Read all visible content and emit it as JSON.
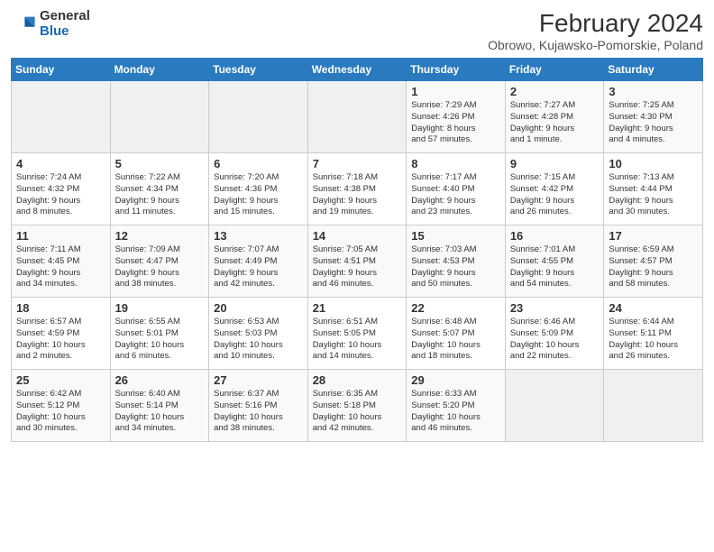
{
  "header": {
    "logo_general": "General",
    "logo_blue": "Blue",
    "title": "February 2024",
    "subtitle": "Obrowo, Kujawsko-Pomorskie, Poland"
  },
  "weekdays": [
    "Sunday",
    "Monday",
    "Tuesday",
    "Wednesday",
    "Thursday",
    "Friday",
    "Saturday"
  ],
  "weeks": [
    [
      {
        "day": "",
        "info": ""
      },
      {
        "day": "",
        "info": ""
      },
      {
        "day": "",
        "info": ""
      },
      {
        "day": "",
        "info": ""
      },
      {
        "day": "1",
        "info": "Sunrise: 7:29 AM\nSunset: 4:26 PM\nDaylight: 8 hours\nand 57 minutes."
      },
      {
        "day": "2",
        "info": "Sunrise: 7:27 AM\nSunset: 4:28 PM\nDaylight: 9 hours\nand 1 minute."
      },
      {
        "day": "3",
        "info": "Sunrise: 7:25 AM\nSunset: 4:30 PM\nDaylight: 9 hours\nand 4 minutes."
      }
    ],
    [
      {
        "day": "4",
        "info": "Sunrise: 7:24 AM\nSunset: 4:32 PM\nDaylight: 9 hours\nand 8 minutes."
      },
      {
        "day": "5",
        "info": "Sunrise: 7:22 AM\nSunset: 4:34 PM\nDaylight: 9 hours\nand 11 minutes."
      },
      {
        "day": "6",
        "info": "Sunrise: 7:20 AM\nSunset: 4:36 PM\nDaylight: 9 hours\nand 15 minutes."
      },
      {
        "day": "7",
        "info": "Sunrise: 7:18 AM\nSunset: 4:38 PM\nDaylight: 9 hours\nand 19 minutes."
      },
      {
        "day": "8",
        "info": "Sunrise: 7:17 AM\nSunset: 4:40 PM\nDaylight: 9 hours\nand 23 minutes."
      },
      {
        "day": "9",
        "info": "Sunrise: 7:15 AM\nSunset: 4:42 PM\nDaylight: 9 hours\nand 26 minutes."
      },
      {
        "day": "10",
        "info": "Sunrise: 7:13 AM\nSunset: 4:44 PM\nDaylight: 9 hours\nand 30 minutes."
      }
    ],
    [
      {
        "day": "11",
        "info": "Sunrise: 7:11 AM\nSunset: 4:45 PM\nDaylight: 9 hours\nand 34 minutes."
      },
      {
        "day": "12",
        "info": "Sunrise: 7:09 AM\nSunset: 4:47 PM\nDaylight: 9 hours\nand 38 minutes."
      },
      {
        "day": "13",
        "info": "Sunrise: 7:07 AM\nSunset: 4:49 PM\nDaylight: 9 hours\nand 42 minutes."
      },
      {
        "day": "14",
        "info": "Sunrise: 7:05 AM\nSunset: 4:51 PM\nDaylight: 9 hours\nand 46 minutes."
      },
      {
        "day": "15",
        "info": "Sunrise: 7:03 AM\nSunset: 4:53 PM\nDaylight: 9 hours\nand 50 minutes."
      },
      {
        "day": "16",
        "info": "Sunrise: 7:01 AM\nSunset: 4:55 PM\nDaylight: 9 hours\nand 54 minutes."
      },
      {
        "day": "17",
        "info": "Sunrise: 6:59 AM\nSunset: 4:57 PM\nDaylight: 9 hours\nand 58 minutes."
      }
    ],
    [
      {
        "day": "18",
        "info": "Sunrise: 6:57 AM\nSunset: 4:59 PM\nDaylight: 10 hours\nand 2 minutes."
      },
      {
        "day": "19",
        "info": "Sunrise: 6:55 AM\nSunset: 5:01 PM\nDaylight: 10 hours\nand 6 minutes."
      },
      {
        "day": "20",
        "info": "Sunrise: 6:53 AM\nSunset: 5:03 PM\nDaylight: 10 hours\nand 10 minutes."
      },
      {
        "day": "21",
        "info": "Sunrise: 6:51 AM\nSunset: 5:05 PM\nDaylight: 10 hours\nand 14 minutes."
      },
      {
        "day": "22",
        "info": "Sunrise: 6:48 AM\nSunset: 5:07 PM\nDaylight: 10 hours\nand 18 minutes."
      },
      {
        "day": "23",
        "info": "Sunrise: 6:46 AM\nSunset: 5:09 PM\nDaylight: 10 hours\nand 22 minutes."
      },
      {
        "day": "24",
        "info": "Sunrise: 6:44 AM\nSunset: 5:11 PM\nDaylight: 10 hours\nand 26 minutes."
      }
    ],
    [
      {
        "day": "25",
        "info": "Sunrise: 6:42 AM\nSunset: 5:12 PM\nDaylight: 10 hours\nand 30 minutes."
      },
      {
        "day": "26",
        "info": "Sunrise: 6:40 AM\nSunset: 5:14 PM\nDaylight: 10 hours\nand 34 minutes."
      },
      {
        "day": "27",
        "info": "Sunrise: 6:37 AM\nSunset: 5:16 PM\nDaylight: 10 hours\nand 38 minutes."
      },
      {
        "day": "28",
        "info": "Sunrise: 6:35 AM\nSunset: 5:18 PM\nDaylight: 10 hours\nand 42 minutes."
      },
      {
        "day": "29",
        "info": "Sunrise: 6:33 AM\nSunset: 5:20 PM\nDaylight: 10 hours\nand 46 minutes."
      },
      {
        "day": "",
        "info": ""
      },
      {
        "day": "",
        "info": ""
      }
    ]
  ]
}
